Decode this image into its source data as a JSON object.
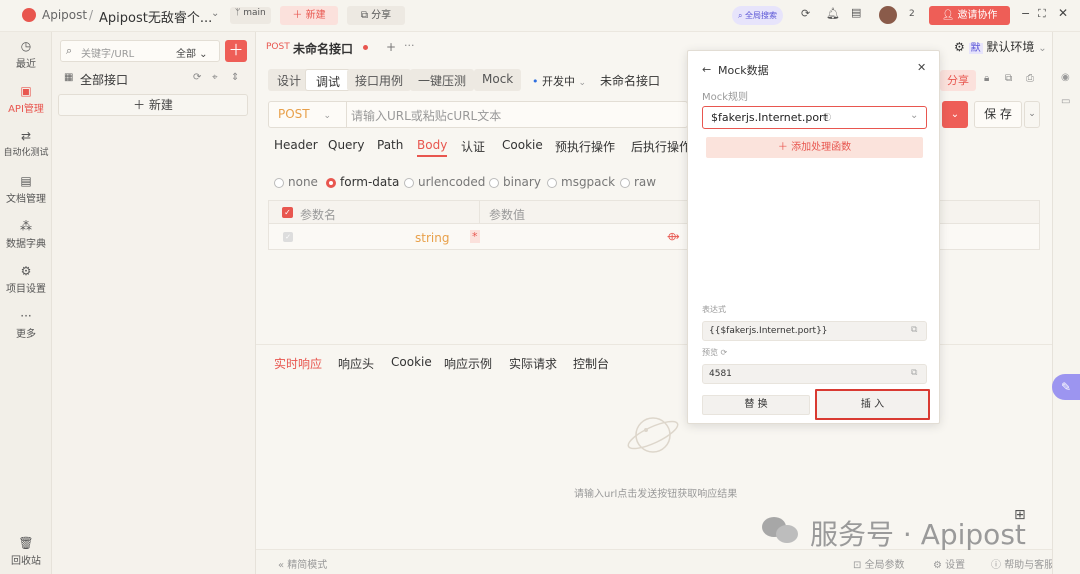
{
  "topbar": {
    "app_name": "Apipost",
    "separator": "/",
    "project_name": "Apipost无敌睿个...",
    "branch": "main",
    "new_label": "新建",
    "share_label": "分享",
    "global_search": "全局搜索",
    "notification_count": "2",
    "invite_label": "邀请协作"
  },
  "nav": [
    {
      "label": "最近",
      "icon": "clock-icon"
    },
    {
      "label": "API管理",
      "icon": "api-icon"
    },
    {
      "label": "自动化测试",
      "icon": "automation-icon"
    },
    {
      "label": "文档管理",
      "icon": "document-icon"
    },
    {
      "label": "数据字典",
      "icon": "dictionary-icon"
    },
    {
      "label": "项目设置",
      "icon": "settings-icon"
    },
    {
      "label": "更多",
      "icon": "more-icon"
    },
    {
      "label": "回收站",
      "icon": "trash-icon"
    }
  ],
  "tree": {
    "search_placeholder": "关键字/URL",
    "filter": "全部",
    "all_label": "全部接口",
    "new_label": "新建"
  },
  "request_tab": {
    "method_tag": "POST",
    "name": "未命名接口",
    "env_badge": "默",
    "env_label": "默认环境"
  },
  "subtabs": [
    "设计",
    "调试",
    "接口用例",
    "一键压测",
    "Mock"
  ],
  "status": "开发中",
  "doc_name": "未命名接口",
  "share_label": "分享",
  "url_bar": {
    "method": "POST",
    "placeholder": "请输入URL或粘贴cURL文本",
    "save_label": "保 存"
  },
  "param_tabs": [
    "Header",
    "Query",
    "Path",
    "Body",
    "认证",
    "Cookie",
    "预执行操作",
    "后执行操作"
  ],
  "body_types": [
    "none",
    "form-data",
    "urlencoded",
    "binary",
    "msgpack",
    "raw"
  ],
  "param_table": {
    "headers": [
      "参数名",
      "参数值"
    ],
    "row": {
      "type": "string",
      "required_mark": "*"
    }
  },
  "response_tabs": [
    "实时响应",
    "响应头",
    "Cookie",
    "响应示例",
    "实际请求",
    "控制台"
  ],
  "response_empty": "请输入url点击发送按钮获取响应结果",
  "mock_popup": {
    "title": "Mock数据",
    "rule_label": "Mock规则",
    "rule_value": "$fakerjs.Internet.port",
    "add_fn_label": "添加处理函数",
    "expr_label": "表达式",
    "expr_value": "{{$fakerjs.Internet.port}}",
    "preview_label": "预览",
    "preview_value": "4581",
    "replace_label": "替 换",
    "insert_label": "插 入"
  },
  "watermark": "服务号 · Apipost",
  "footer": {
    "compact_mode": "精简模式",
    "global_params": "全局参数",
    "settings": "设置",
    "help": "帮助与客服"
  },
  "colors": {
    "accent": "#e8564f",
    "background": "#f8f6f1"
  }
}
